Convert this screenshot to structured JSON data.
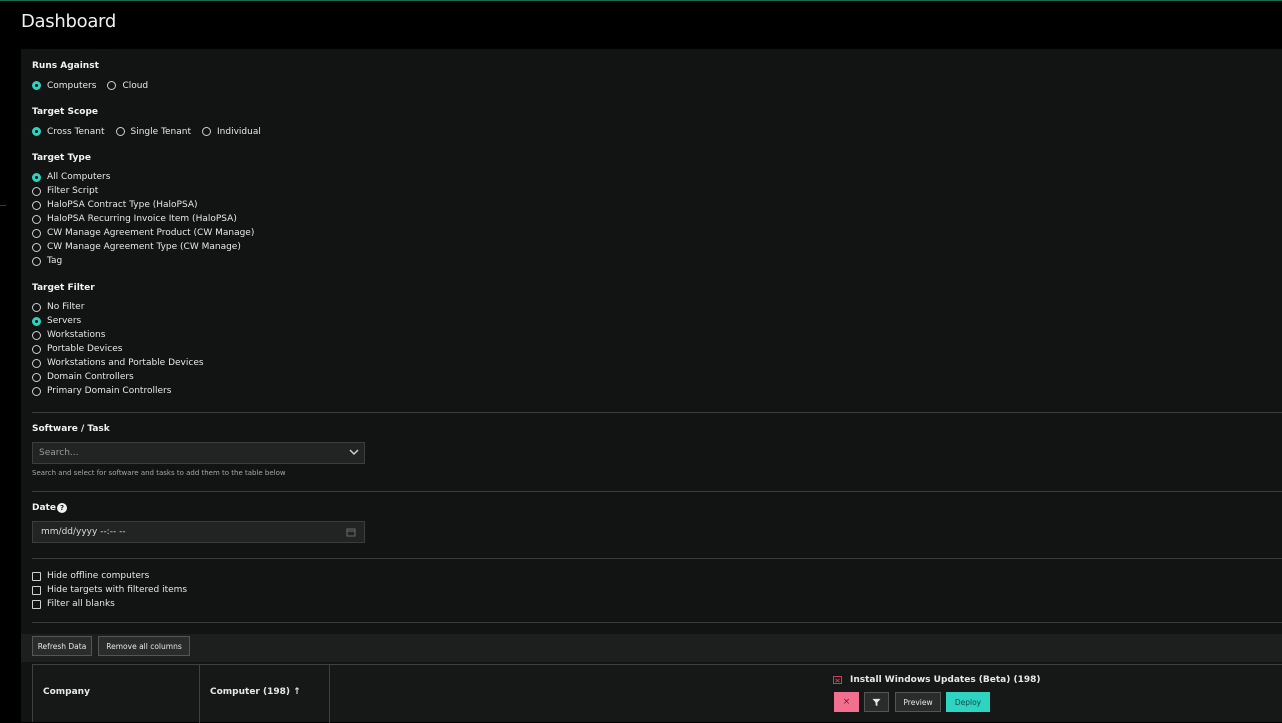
{
  "header": {
    "title": "Dashboard"
  },
  "runs_against": {
    "label": "Runs Against",
    "options": [
      {
        "label": "Computers",
        "selected": true
      },
      {
        "label": "Cloud",
        "selected": false
      }
    ]
  },
  "target_scope": {
    "label": "Target Scope",
    "options": [
      {
        "label": "Cross Tenant",
        "selected": true
      },
      {
        "label": "Single Tenant",
        "selected": false
      },
      {
        "label": "Individual",
        "selected": false
      }
    ]
  },
  "target_type": {
    "label": "Target Type",
    "options": [
      {
        "label": "All Computers",
        "selected": true
      },
      {
        "label": "Filter Script",
        "selected": false
      },
      {
        "label": "HaloPSA Contract Type (HaloPSA)",
        "selected": false
      },
      {
        "label": "HaloPSA Recurring Invoice Item (HaloPSA)",
        "selected": false
      },
      {
        "label": "CW Manage Agreement Product (CW Manage)",
        "selected": false
      },
      {
        "label": "CW Manage Agreement Type (CW Manage)",
        "selected": false
      },
      {
        "label": "Tag",
        "selected": false
      }
    ]
  },
  "target_filter": {
    "label": "Target Filter",
    "options": [
      {
        "label": "No Filter",
        "selected": false
      },
      {
        "label": "Servers",
        "selected": true
      },
      {
        "label": "Workstations",
        "selected": false
      },
      {
        "label": "Portable Devices",
        "selected": false
      },
      {
        "label": "Workstations and Portable Devices",
        "selected": false
      },
      {
        "label": "Domain Controllers",
        "selected": false
      },
      {
        "label": "Primary Domain Controllers",
        "selected": false
      }
    ]
  },
  "software_task": {
    "label": "Software / Task",
    "placeholder": "Search...",
    "helper": "Search and select for software and tasks to add them to the table below"
  },
  "date": {
    "label": "Date",
    "help_icon": "?",
    "value": "mm/dd/yyyy --:-- --"
  },
  "options": {
    "items": [
      {
        "label": "Hide offline computers",
        "checked": false
      },
      {
        "label": "Hide targets with filtered items",
        "checked": false
      },
      {
        "label": "Filter all blanks",
        "checked": false
      }
    ]
  },
  "toolbar": {
    "refresh_label": "Refresh Data",
    "remove_columns_label": "Remove all columns"
  },
  "table": {
    "columns": {
      "company": "Company",
      "computer": "Computer (198)",
      "sort_indicator": "↑",
      "task": "Install Windows Updates (Beta) (198)"
    },
    "task_buttons": {
      "remove": "×",
      "preview": "Preview",
      "deploy": "Deploy"
    }
  },
  "colors": {
    "accent": "#2ed3c1",
    "remove_button": "#f26f8f",
    "background": "#121313"
  }
}
